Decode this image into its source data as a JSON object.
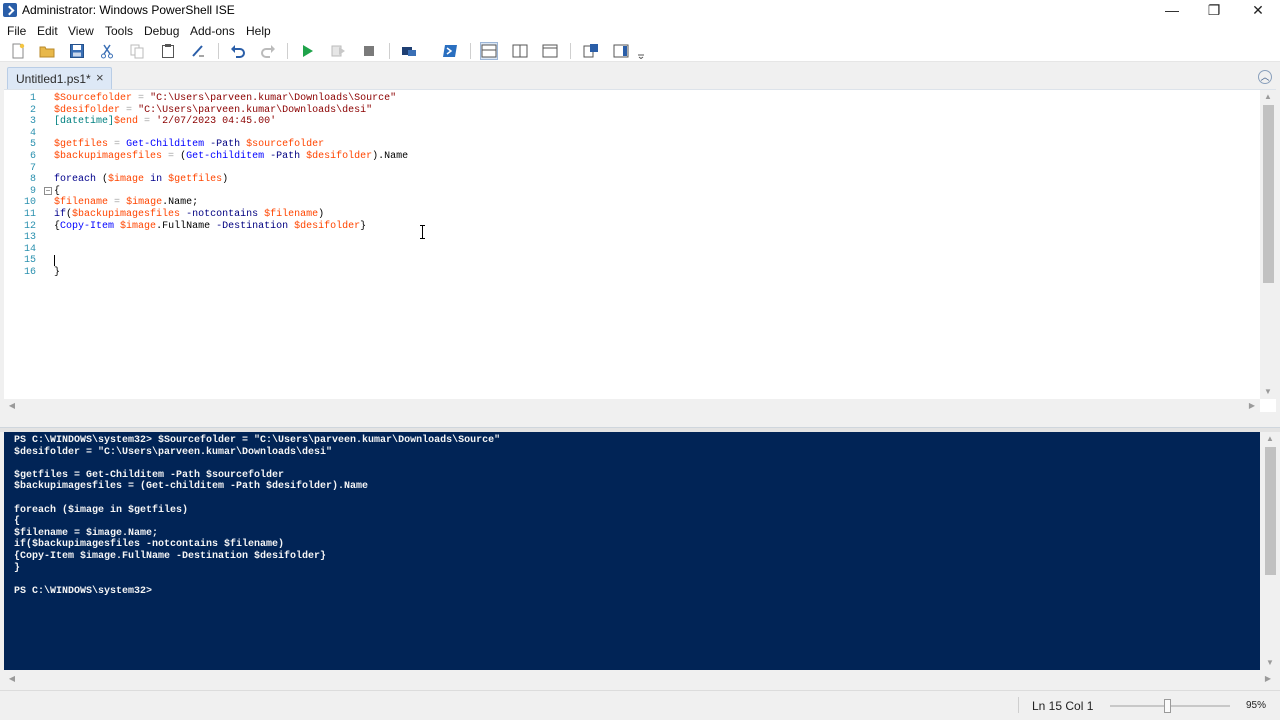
{
  "window": {
    "title": "Administrator: Windows PowerShell ISE",
    "minimize": "—",
    "restore": "❐",
    "close": "✕"
  },
  "menu": [
    "File",
    "Edit",
    "View",
    "Tools",
    "Debug",
    "Add-ons",
    "Help"
  ],
  "toolbar_icons": [
    "new-file-icon",
    "open-file-icon",
    "save-icon",
    "cut-icon",
    "copy-icon",
    "paste-icon",
    "clear-console-icon",
    "undo-icon",
    "redo-icon",
    "run-script-icon",
    "run-selection-icon",
    "stop-icon",
    "new-remote-tab-icon",
    "start-powershell-icon",
    "show-script-top-icon",
    "show-script-right-icon",
    "show-script-maximized-icon",
    "show-command-window-icon",
    "show-command-addon-icon"
  ],
  "tabs": [
    {
      "label": "Untitled1.ps1*",
      "close": "×"
    }
  ],
  "script": {
    "line_numbers": [
      "1",
      "2",
      "3",
      "4",
      "5",
      "6",
      "7",
      "8",
      "9",
      "10",
      "11",
      "12",
      "13",
      "14",
      "15",
      "16"
    ],
    "lines": [
      "$Sourcefolder = \"C:\\Users\\parveen.kumar\\Downloads\\Source\"",
      "$desifolder = \"C:\\Users\\parveen.kumar\\Downloads\\desi\"",
      "[datetime]$end = '2/07/2023 04:45.00'",
      "",
      "$getfiles = Get-Childitem -Path $sourcefolder",
      "$backupimagesfiles = (Get-childitem -Path $desifolder).Name",
      "",
      "foreach ($image in $getfiles)",
      "{",
      "$filename = $image.Name;",
      "if($backupimagesfiles -notcontains $filename)",
      "{Copy-Item $image.FullName -Destination $desifolder}",
      "",
      "",
      "",
      "}"
    ]
  },
  "console": {
    "lines": [
      "PS C:\\WINDOWS\\system32> $Sourcefolder = \"C:\\Users\\parveen.kumar\\Downloads\\Source\"",
      "$desifolder = \"C:\\Users\\parveen.kumar\\Downloads\\desi\"",
      "",
      "$getfiles = Get-Childitem -Path $sourcefolder",
      "$backupimagesfiles = (Get-childitem -Path $desifolder).Name",
      "",
      "foreach ($image in $getfiles)",
      "{",
      "$filename = $image.Name;",
      "if($backupimagesfiles -notcontains $filename)",
      "{Copy-Item $image.FullName -Destination $desifolder}",
      "}",
      "",
      "PS C:\\WINDOWS\\system32>"
    ]
  },
  "status": {
    "position": "Ln 15  Col 1",
    "zoom": "95%",
    "zoom_level": 0.475
  },
  "colors": {
    "console_bg": "#012456",
    "variable": "#ff4500",
    "string": "#8b0000",
    "command": "#0000ff",
    "keyword": "#00008b"
  }
}
